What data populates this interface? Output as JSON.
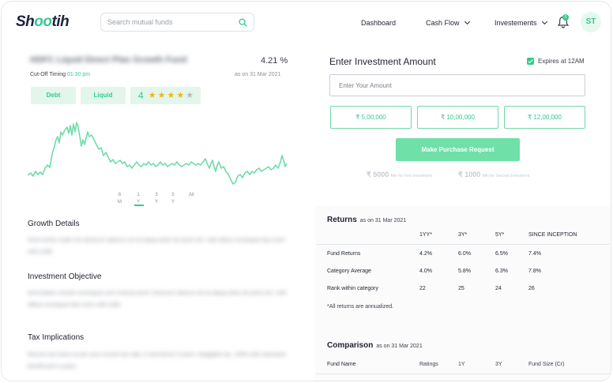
{
  "header": {
    "logo_prefix": "Sh",
    "logo_leaf": "oo",
    "logo_suffix": "tih",
    "search_placeholder": "Search mutual funds",
    "nav": [
      "Dashboard",
      "Cash Flow",
      "Investements"
    ],
    "notification_count": "0",
    "avatar": "ST"
  },
  "fund": {
    "name": "HDFC Liquid Direct Plan Growth Fund",
    "return": "4.21 %",
    "cutoff_label": "Cut-Off Timing",
    "cutoff_time": "01:30 pm",
    "as_on": "as on 31 Mar 2021",
    "tags": [
      "Debt",
      "Liquid"
    ],
    "rating": 4,
    "rating_label": "4",
    "chart_ranges": [
      {
        "top": "6",
        "bottom": "M"
      },
      {
        "top": "1",
        "bottom": "Y"
      },
      {
        "top": "3",
        "bottom": "Y"
      },
      {
        "top": "5",
        "bottom": "Y"
      },
      {
        "top": "All",
        "bottom": ""
      }
    ]
  },
  "sections": {
    "growth_title": "Growth Details",
    "growth_text": "Amet minim mollit non deserunt ullamco est sit aliqua dolor do amet sint. Velit officia consequat duis enim velit mollit.",
    "objective_title": "Investment Objective",
    "objective_text": "Exercitation veniam consequat sunt nostrud amet. Deserunt ullamco est sit aliqua dolor do amet sint. Velit officia consequat duis enim velit mollit.",
    "tax_title": "Tax Implications",
    "tax_text": "Returns are taxes as per your income tax slab, if sold before 3 years. Negligible tax. 100% with indexation benefit post 3 years."
  },
  "investment": {
    "title": "Enter Investment Amount",
    "expires": "Expires at 12AM",
    "amount_placeholder": "Enter Your Amount",
    "presets": [
      "₹ 5,00,000",
      "₹ 10,00,000",
      "₹ 12,00,000"
    ],
    "buy_label": "Make Purchase Request",
    "min_first": "₹ 5000",
    "min_first_note": "Min for First Investment",
    "min_second": "₹ 1000",
    "min_second_note": "Min for Second Investment"
  },
  "returns": {
    "title": "Returns",
    "as_on": "as on 31 Mar 2021",
    "columns": [
      "1YY*",
      "3Y*",
      "5Y*",
      "SINCE INCEPTION"
    ],
    "rows": [
      {
        "label": "Fund Returns",
        "values": [
          "4.2%",
          "6.0%",
          "6.5%",
          "7.4%"
        ]
      },
      {
        "label": "Category Average",
        "values": [
          "4.0%",
          "5.8%",
          "6.3%",
          "7.8%"
        ]
      },
      {
        "label": "Rank within category",
        "values": [
          "22",
          "25",
          "24",
          "26"
        ]
      }
    ],
    "note": "*All returns are annualized."
  },
  "comparison": {
    "title": "Comparison",
    "as_on": "as on 31 Mar 2021",
    "columns": [
      "Fund Name",
      "Ratings",
      "1Y",
      "3Y",
      "Fund Size (Cr)"
    ]
  },
  "colors": {
    "accent": "#35c98c",
    "accent_light": "#e3f6ec",
    "button": "#6fe0a8"
  }
}
